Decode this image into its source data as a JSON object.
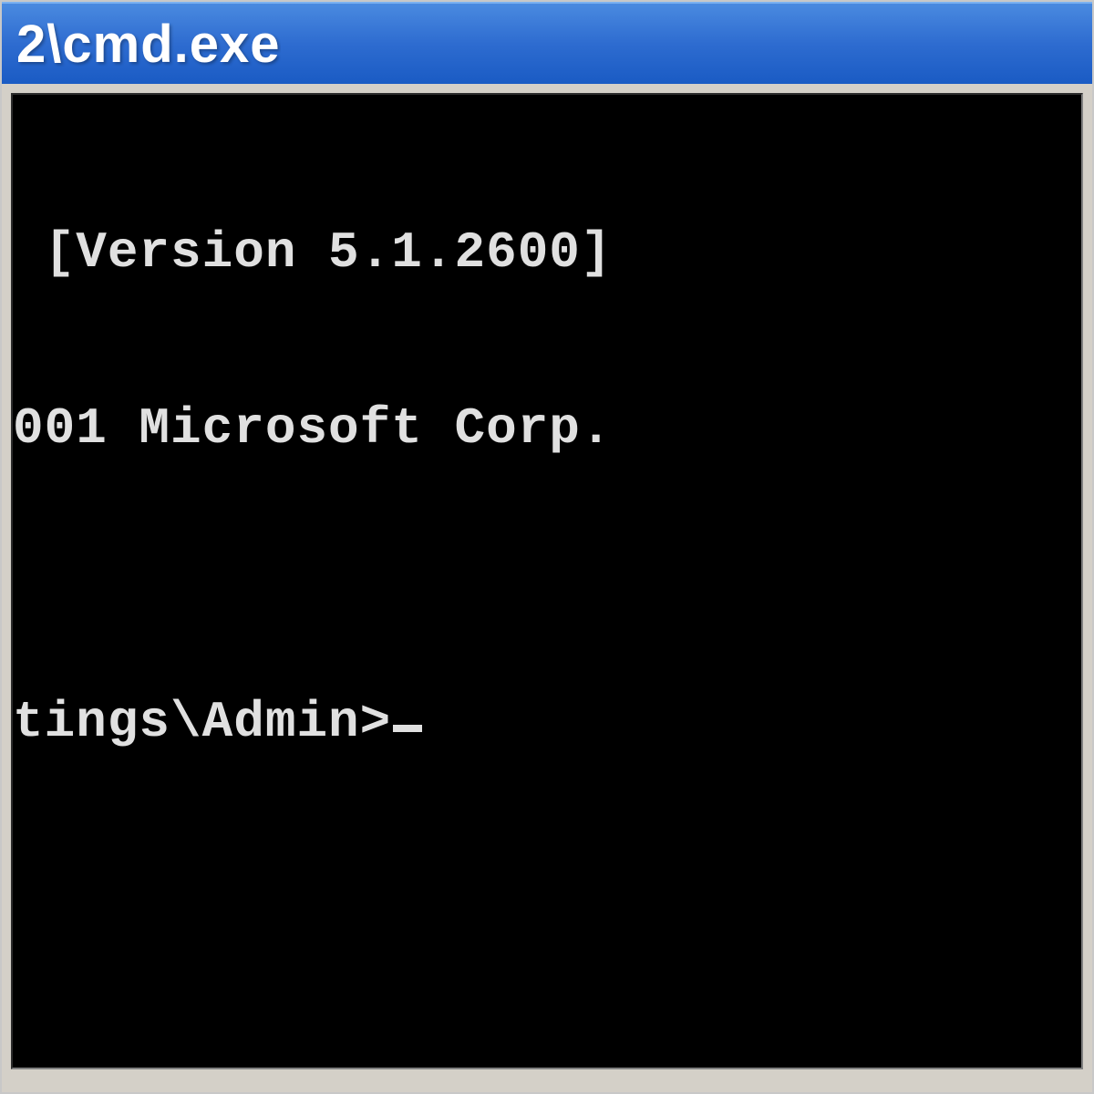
{
  "window": {
    "title": "2\\cmd.exe"
  },
  "console": {
    "lines": [
      " [Version 5.1.2600]",
      "001 Microsoft Corp.",
      "",
      "tings\\Admin>"
    ],
    "cursor_char": "_"
  },
  "colors": {
    "titlebar_top": "#4a8ae0",
    "titlebar_bottom": "#1a5bc4",
    "console_bg": "#000000",
    "console_fg": "#e0e0e0",
    "frame": "#d4d0c8"
  }
}
